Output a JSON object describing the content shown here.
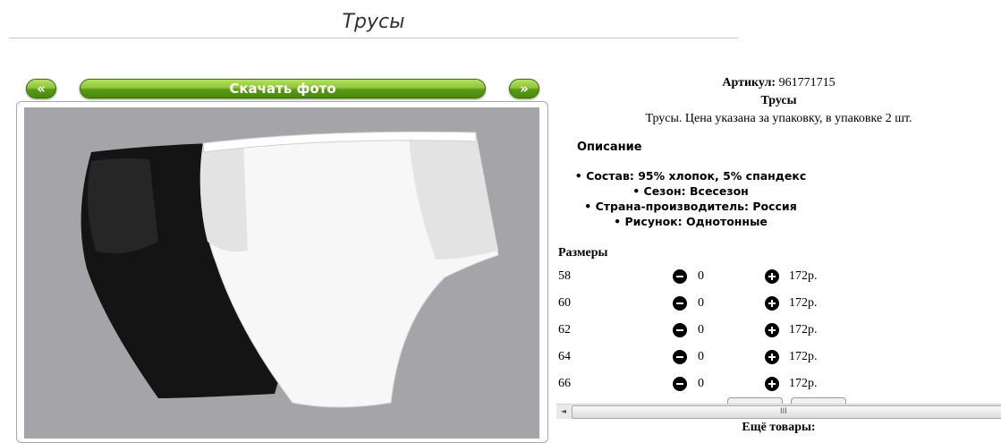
{
  "page": {
    "title": "Трусы"
  },
  "gallery": {
    "prev_label": "«",
    "download_label": "Скачать фото",
    "next_label": "»"
  },
  "product": {
    "sku_label": "Артикул:",
    "sku": "961771715",
    "name": "Трусы",
    "description": "Трусы. Цена указана за упаковку, в упаковке 2 шт.",
    "desc_heading": "Описание",
    "properties": [
      "Состав: 95% хлопок, 5% спандекс",
      "Сезон: Всесезон",
      "Страна-производитель: Россия",
      "Рисунок: Однотонные"
    ]
  },
  "sizes": {
    "heading": "Размеры",
    "rows": [
      {
        "size": "58",
        "qty": "0",
        "price": "172р."
      },
      {
        "size": "60",
        "qty": "0",
        "price": "172р."
      },
      {
        "size": "62",
        "qty": "0",
        "price": "172р."
      },
      {
        "size": "64",
        "qty": "0",
        "price": "172р."
      },
      {
        "size": "66",
        "qty": "0",
        "price": "172р."
      }
    ]
  },
  "scrollbar": {
    "left_arrow": "◄",
    "grip": "III"
  },
  "more": {
    "label": "Ещё товары:"
  },
  "icons": {
    "minus": "minus-circle-icon",
    "plus": "plus-circle-icon"
  }
}
